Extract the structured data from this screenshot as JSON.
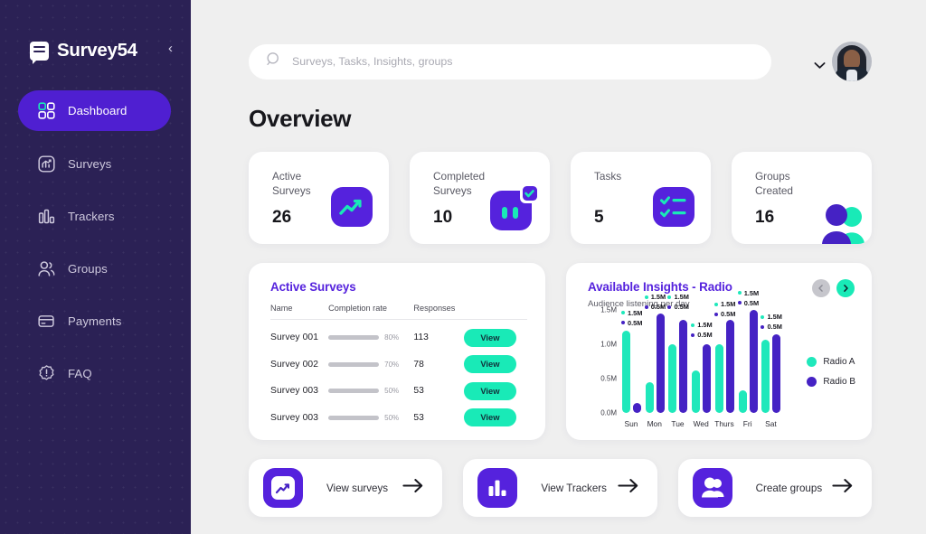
{
  "sidebar": {
    "brand": "Survey54",
    "collapse_icon": "chevron-left-icon",
    "items": [
      {
        "label": "Dashboard",
        "icon": "grid-icon",
        "active": true
      },
      {
        "label": "Surveys",
        "icon": "survey-chart-icon",
        "active": false
      },
      {
        "label": "Trackers",
        "icon": "bar-chart-icon",
        "active": false
      },
      {
        "label": "Groups",
        "icon": "people-icon",
        "active": false
      },
      {
        "label": "Payments",
        "icon": "credit-card-icon",
        "active": false
      },
      {
        "label": "FAQ",
        "icon": "question-badge-icon",
        "active": false
      }
    ]
  },
  "topbar": {
    "search_placeholder": "Surveys, Tasks, Insights, groups",
    "search_value": "",
    "search_icon": "search-icon",
    "chevron_icon": "chevron-down-icon",
    "avatar": "user-avatar"
  },
  "page_title": "Overview",
  "stats": [
    {
      "label": "Active\nSurveys",
      "label_l1": "Active",
      "label_l2": "Surveys",
      "value": "26",
      "icon": "trending-up-icon"
    },
    {
      "label": "Completed Surveys",
      "label_l1": "Completed",
      "label_l2": "Surveys",
      "value": "10",
      "icon": "survey-complete-check-icon"
    },
    {
      "label": "Tasks",
      "label_l1": "Tasks",
      "label_l2": "",
      "value": "5",
      "icon": "checklist-icon"
    },
    {
      "label": "Groups Created",
      "label_l1": "Groups",
      "label_l2": "Created",
      "value": "16",
      "icon": "group-people-icon"
    }
  ],
  "active_surveys": {
    "title": "Active Surveys",
    "columns": [
      "Name",
      "Completion rate",
      "Responses",
      ""
    ],
    "rows": [
      {
        "name": "Survey 001",
        "rate": 80,
        "rate_label": "80%",
        "responses": "113",
        "action": "View"
      },
      {
        "name": "Survey 002",
        "rate": 70,
        "rate_label": "70%",
        "responses": "78",
        "action": "View"
      },
      {
        "name": "Survey 003",
        "rate": 50,
        "rate_label": "50%",
        "responses": "53",
        "action": "View"
      },
      {
        "name": "Survey 003",
        "rate": 50,
        "rate_label": "50%",
        "responses": "53",
        "action": "View"
      }
    ]
  },
  "insights": {
    "title": "Available Insights - Radio",
    "subtitle": "Audience listening per day",
    "prev_icon": "chevron-left-circle-icon",
    "next_icon": "chevron-right-circle-icon",
    "prev_enabled": false,
    "next_enabled": true
  },
  "chart_data": {
    "type": "bar",
    "title": "Available Insights - Radio",
    "subtitle": "Audience listening per day",
    "xlabel": "",
    "ylabel": "",
    "ylim": [
      0,
      1.5
    ],
    "yticks": [
      "0.0M",
      "0.5M",
      "1.0M",
      "1.5M"
    ],
    "ytick_values": [
      0,
      0.5,
      1.0,
      1.5
    ],
    "grid": false,
    "legend_position": "right",
    "categories": [
      "Sun",
      "Mon",
      "Tue",
      "Wed",
      "Thurs",
      "Fri",
      "Sat"
    ],
    "series": [
      {
        "name": "Radio A",
        "color": "#1fe8bb",
        "values": [
          1.2,
          0.45,
          1.0,
          0.62,
          1.0,
          0.33,
          1.07
        ]
      },
      {
        "name": "Radio B",
        "color": "#4522c4",
        "values": [
          0.15,
          1.45,
          1.35,
          1.0,
          1.35,
          1.5,
          1.15
        ]
      }
    ],
    "point_labels": [
      {
        "a": "1.5M",
        "b": "0.5M"
      },
      {
        "a": "1.5M",
        "b": "0.5M"
      },
      {
        "a": "1.5M",
        "b": "0.5M"
      },
      {
        "a": "1.5M",
        "b": "0.5M"
      },
      {
        "a": "1.5M",
        "b": "0.5M"
      },
      {
        "a": "1.5M",
        "b": "0.5M"
      },
      {
        "a": "1.5M",
        "b": "0.5M"
      }
    ]
  },
  "actions": [
    {
      "label": "View surveys",
      "icon": "trending-up-icon",
      "arrow": "arrow-right-icon"
    },
    {
      "label": "View Trackers",
      "icon": "bar-chart-icon",
      "arrow": "arrow-right-icon"
    },
    {
      "label": "Create groups",
      "icon": "group-people-icon",
      "arrow": "arrow-right-icon"
    }
  ],
  "colors": {
    "sidebar_bg": "#2b2155",
    "accent_purple": "#5522dd",
    "active_pill": "#4f1fd1",
    "accent_teal": "#19eab7",
    "page_bg": "#efefef",
    "card_bg": "#ffffff"
  }
}
